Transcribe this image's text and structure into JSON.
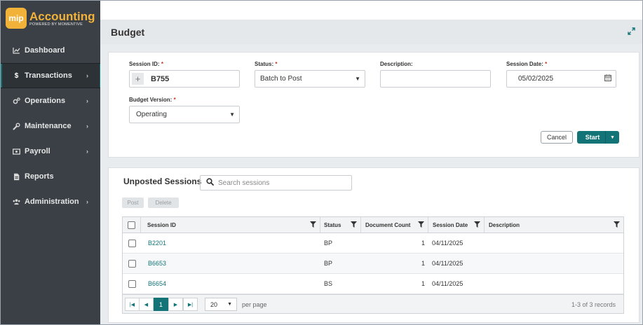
{
  "brand": {
    "badge": "mip",
    "title": "Accounting",
    "subtitle": "POWERED BY MOMENTIVE"
  },
  "sidebar": {
    "items": [
      {
        "label": "Dashboard",
        "icon": "chart-icon",
        "chevron": false,
        "active": false
      },
      {
        "label": "Transactions",
        "icon": "dollar-icon",
        "chevron": true,
        "active": true
      },
      {
        "label": "Operations",
        "icon": "gears-icon",
        "chevron": true,
        "active": false
      },
      {
        "label": "Maintenance",
        "icon": "wrench-icon",
        "chevron": true,
        "active": false
      },
      {
        "label": "Payroll",
        "icon": "money-icon",
        "chevron": true,
        "active": false
      },
      {
        "label": "Reports",
        "icon": "file-icon",
        "chevron": false,
        "active": false
      },
      {
        "label": "Administration",
        "icon": "users-icon",
        "chevron": true,
        "active": false
      }
    ]
  },
  "page": {
    "title": "Budget"
  },
  "form": {
    "session_id": {
      "label": "Session ID:",
      "required": "*",
      "value": "B755"
    },
    "status": {
      "label": "Status:",
      "required": "*",
      "value": "Batch to Post"
    },
    "description": {
      "label": "Description:",
      "value": ""
    },
    "session_date": {
      "label": "Session Date:",
      "required": "*",
      "value": "05/02/2025"
    },
    "budget_version": {
      "label": "Budget Version:",
      "required": "*",
      "value": "Operating"
    },
    "cancel_label": "Cancel",
    "start_label": "Start"
  },
  "list": {
    "title": "Unposted Sessions",
    "search_placeholder": "Search sessions",
    "post_label": "Post",
    "delete_label": "Delete",
    "columns": [
      "Session ID",
      "Status",
      "Document Count",
      "Session Date",
      "Description"
    ],
    "rows": [
      {
        "session_id": "B2201",
        "status": "BP",
        "document_count": "1",
        "session_date": "04/11/2025",
        "description": ""
      },
      {
        "session_id": "B6653",
        "status": "BP",
        "document_count": "1",
        "session_date": "04/11/2025",
        "description": ""
      },
      {
        "session_id": "B6654",
        "status": "BS",
        "document_count": "1",
        "session_date": "04/11/2025",
        "description": ""
      }
    ],
    "pager": {
      "current_page": "1",
      "page_size": "20",
      "per_page_label": "per page",
      "records_text": "1-3 of 3 records"
    }
  },
  "colors": {
    "accent": "#137477",
    "brand_orange": "#f2b23a",
    "sidebar_bg": "#3a4046",
    "required": "#c0392b"
  }
}
